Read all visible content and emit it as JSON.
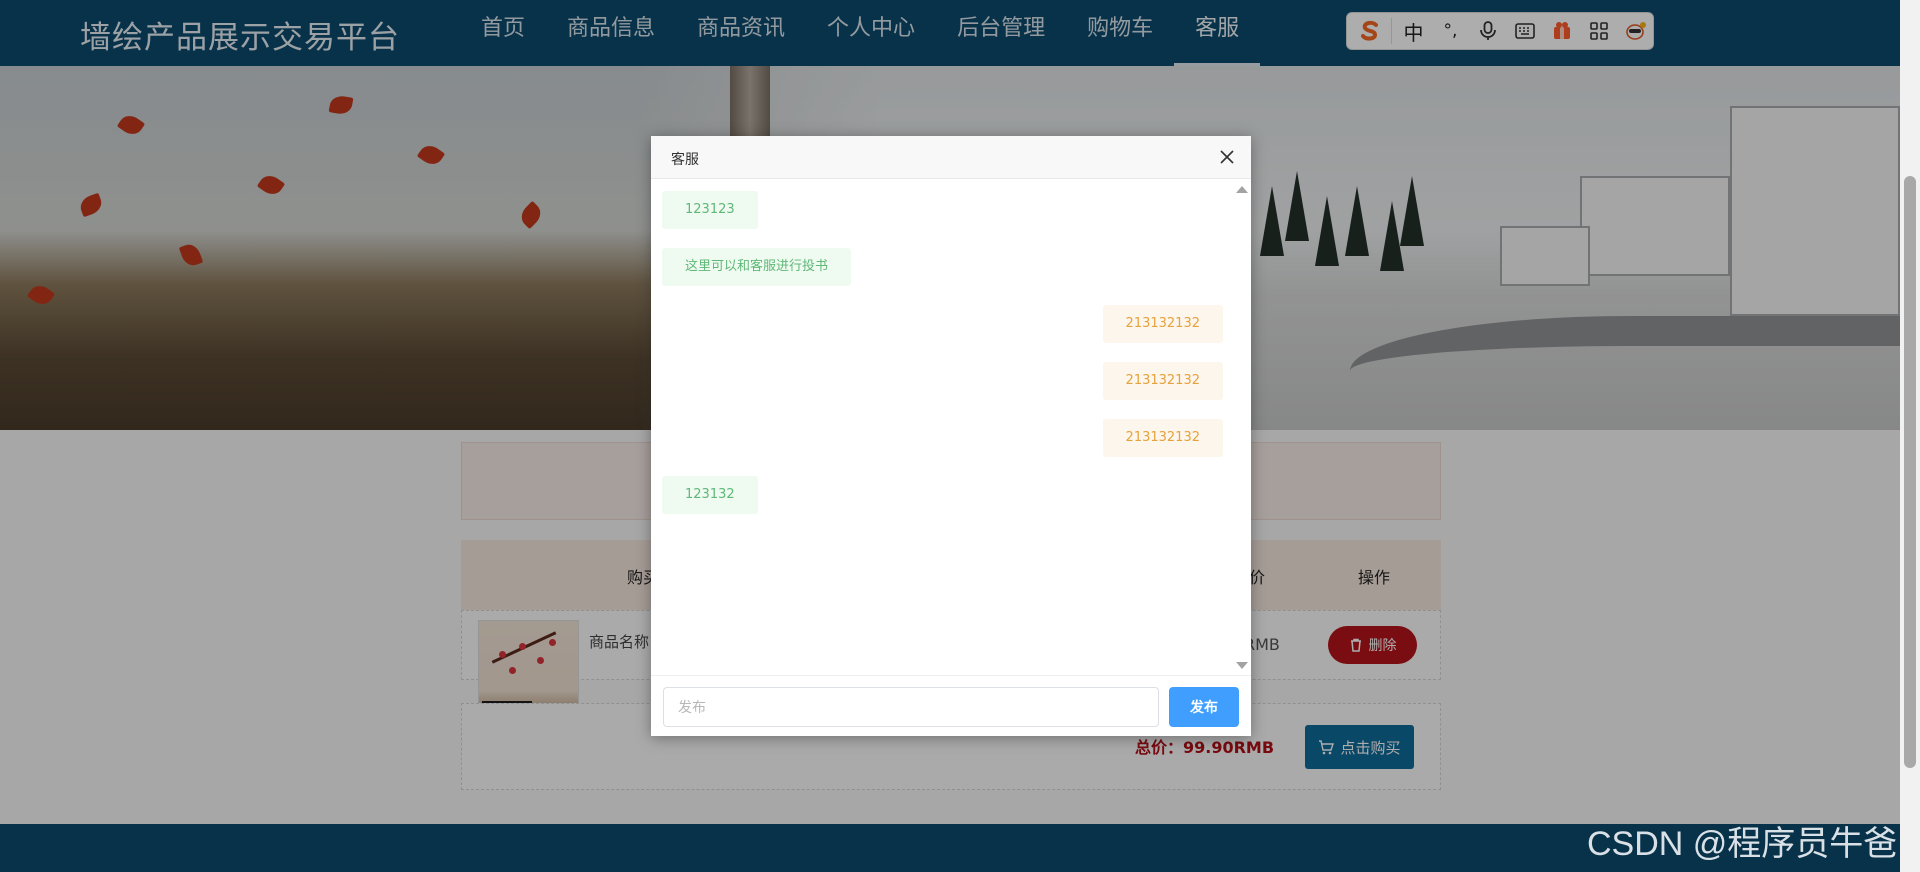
{
  "header": {
    "brand": "墙绘产品展示交易平台",
    "nav": [
      {
        "label": "首页"
      },
      {
        "label": "商品信息"
      },
      {
        "label": "商品资讯"
      },
      {
        "label": "个人中心"
      },
      {
        "label": "后台管理"
      },
      {
        "label": "购物车"
      },
      {
        "label": "客服"
      }
    ],
    "active_nav": "客服"
  },
  "ime_toolbar": {
    "mode_label": "中",
    "punct_label": "°,",
    "icons": [
      "sogou-logo-icon",
      "microphone-icon",
      "keyboard-icon",
      "gift-icon",
      "grid-icon",
      "mascot-icon"
    ]
  },
  "cart": {
    "columns": {
      "buy": "购买",
      "price_tail": "价",
      "action": "操作"
    },
    "item": {
      "name": "商品名称",
      "price_tail": "RMB",
      "delete_label": "删除"
    },
    "total_label": "总价：99.90RMB",
    "buy_label": "点击购买"
  },
  "modal": {
    "title": "客服",
    "messages": [
      {
        "side": "left",
        "text": "123123"
      },
      {
        "side": "left",
        "text": "这里可以和客服进行投书"
      },
      {
        "side": "right",
        "text": "213132132"
      },
      {
        "side": "right",
        "text": "213132132"
      },
      {
        "side": "right",
        "text": "213132132"
      },
      {
        "side": "left",
        "text": "123132"
      }
    ],
    "input_placeholder": "发布",
    "input_value": "",
    "send_label": "发布"
  },
  "watermark": "CSDN @程序员牛爸",
  "colors": {
    "header_bg": "#0d4a6e",
    "send_button": "#409eff",
    "delete_button": "#b3141b",
    "buy_button": "#0f6a99",
    "total_text": "#b10f17",
    "msg_left_text": "#5fb878",
    "msg_right_text": "#e6a23c"
  }
}
